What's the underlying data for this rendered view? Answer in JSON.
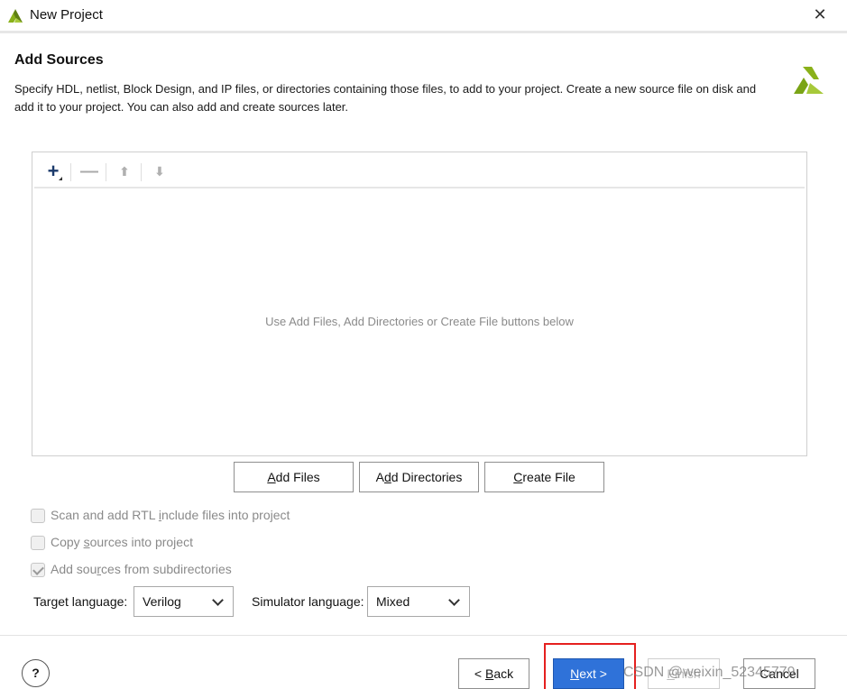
{
  "window": {
    "title": "New Project",
    "close_icon": "close-icon"
  },
  "header": {
    "title": "Add Sources",
    "description": "Specify HDL, netlist, Block Design, and IP files, or directories containing those files, to add to your project. Create a new source file on disk and add it to your project. You can also add and create sources later.",
    "logo_icon": "vivado-logo-icon",
    "accent_color": "#8ab11a"
  },
  "sources_panel": {
    "toolbar": {
      "add_icon": "plus-icon",
      "remove_icon": "minus-icon",
      "move_up_icon": "arrow-up-icon",
      "move_down_icon": "arrow-down-icon"
    },
    "empty_message": "Use Add Files, Add Directories or Create File buttons below"
  },
  "actions": {
    "add_files": {
      "pre": "",
      "mnemonic": "A",
      "post": "dd Files"
    },
    "add_directories": {
      "pre": "A",
      "mnemonic": "d",
      "post": "d Directories"
    },
    "create_file": {
      "pre": "",
      "mnemonic": "C",
      "post": "reate File"
    }
  },
  "options": {
    "scan_rtl": {
      "pre": "Scan and add RTL ",
      "mnemonic": "i",
      "post": "nclude files into project",
      "checked": false,
      "enabled": false
    },
    "copy_sources": {
      "pre": "Copy ",
      "mnemonic": "s",
      "post": "ources into project",
      "checked": false,
      "enabled": false
    },
    "add_subdirs": {
      "pre": "Add sou",
      "mnemonic": "r",
      "post": "ces from subdirectories",
      "checked": true,
      "enabled": false
    }
  },
  "languages": {
    "target_label": "Target language:",
    "target_value": "Verilog",
    "simulator_label": "Simulator language:",
    "simulator_value": "Mixed"
  },
  "footer": {
    "help_label": "?",
    "back": {
      "pre": "< ",
      "mnemonic": "B",
      "post": "ack"
    },
    "next": {
      "pre": "",
      "mnemonic": "N",
      "post": "ext >"
    },
    "finish": {
      "pre": "",
      "mnemonic": "F",
      "post": "inish"
    },
    "cancel": "Cancel",
    "primary_color": "#2f72d9",
    "highlight_color": "#e5201f"
  },
  "watermark": "CSDN @weixin_52345779"
}
